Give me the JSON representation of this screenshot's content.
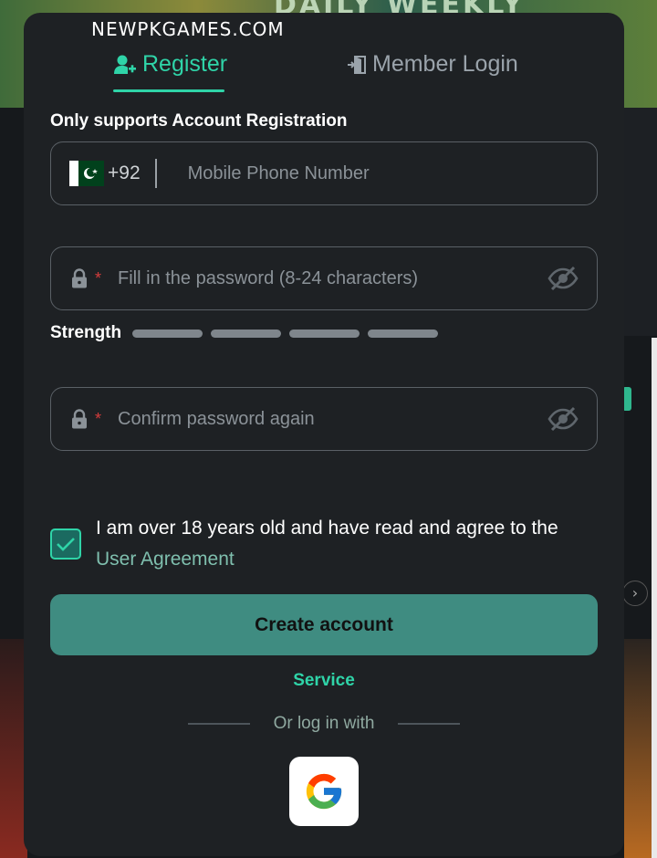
{
  "site": {
    "label": "NEWPKGAMES.COM"
  },
  "background": {
    "banner_text": "DAILY WEEKLY"
  },
  "tabs": {
    "register": {
      "label": "Register",
      "icon": "add-user-icon",
      "active": true
    },
    "login": {
      "label": "Member Login",
      "icon": "login-door-icon",
      "active": false
    }
  },
  "form": {
    "notice": "Only supports Account Registration",
    "phone": {
      "flag": "pakistan-flag-icon",
      "country_code": "+92",
      "placeholder": "Mobile Phone Number",
      "value": ""
    },
    "password": {
      "placeholder": "Fill in the password (8-24 characters)",
      "value": "",
      "required_mark": "*"
    },
    "strength": {
      "label": "Strength",
      "segments": 4,
      "level": 0
    },
    "confirm_password": {
      "placeholder": "Confirm password again",
      "value": "",
      "required_mark": "*"
    },
    "agreement": {
      "checked": true,
      "text": "I am over 18 years old and have read and agree to the",
      "link": "User Agreement"
    },
    "submit_label": "Create account"
  },
  "service_label": "Service",
  "social": {
    "or_text": "Or log in with",
    "providers": [
      "google-icon"
    ]
  },
  "colors": {
    "accent": "#2fd4a8",
    "button": "#3f8c81",
    "modal_bg": "#1e2124",
    "required": "#d43c3c"
  }
}
